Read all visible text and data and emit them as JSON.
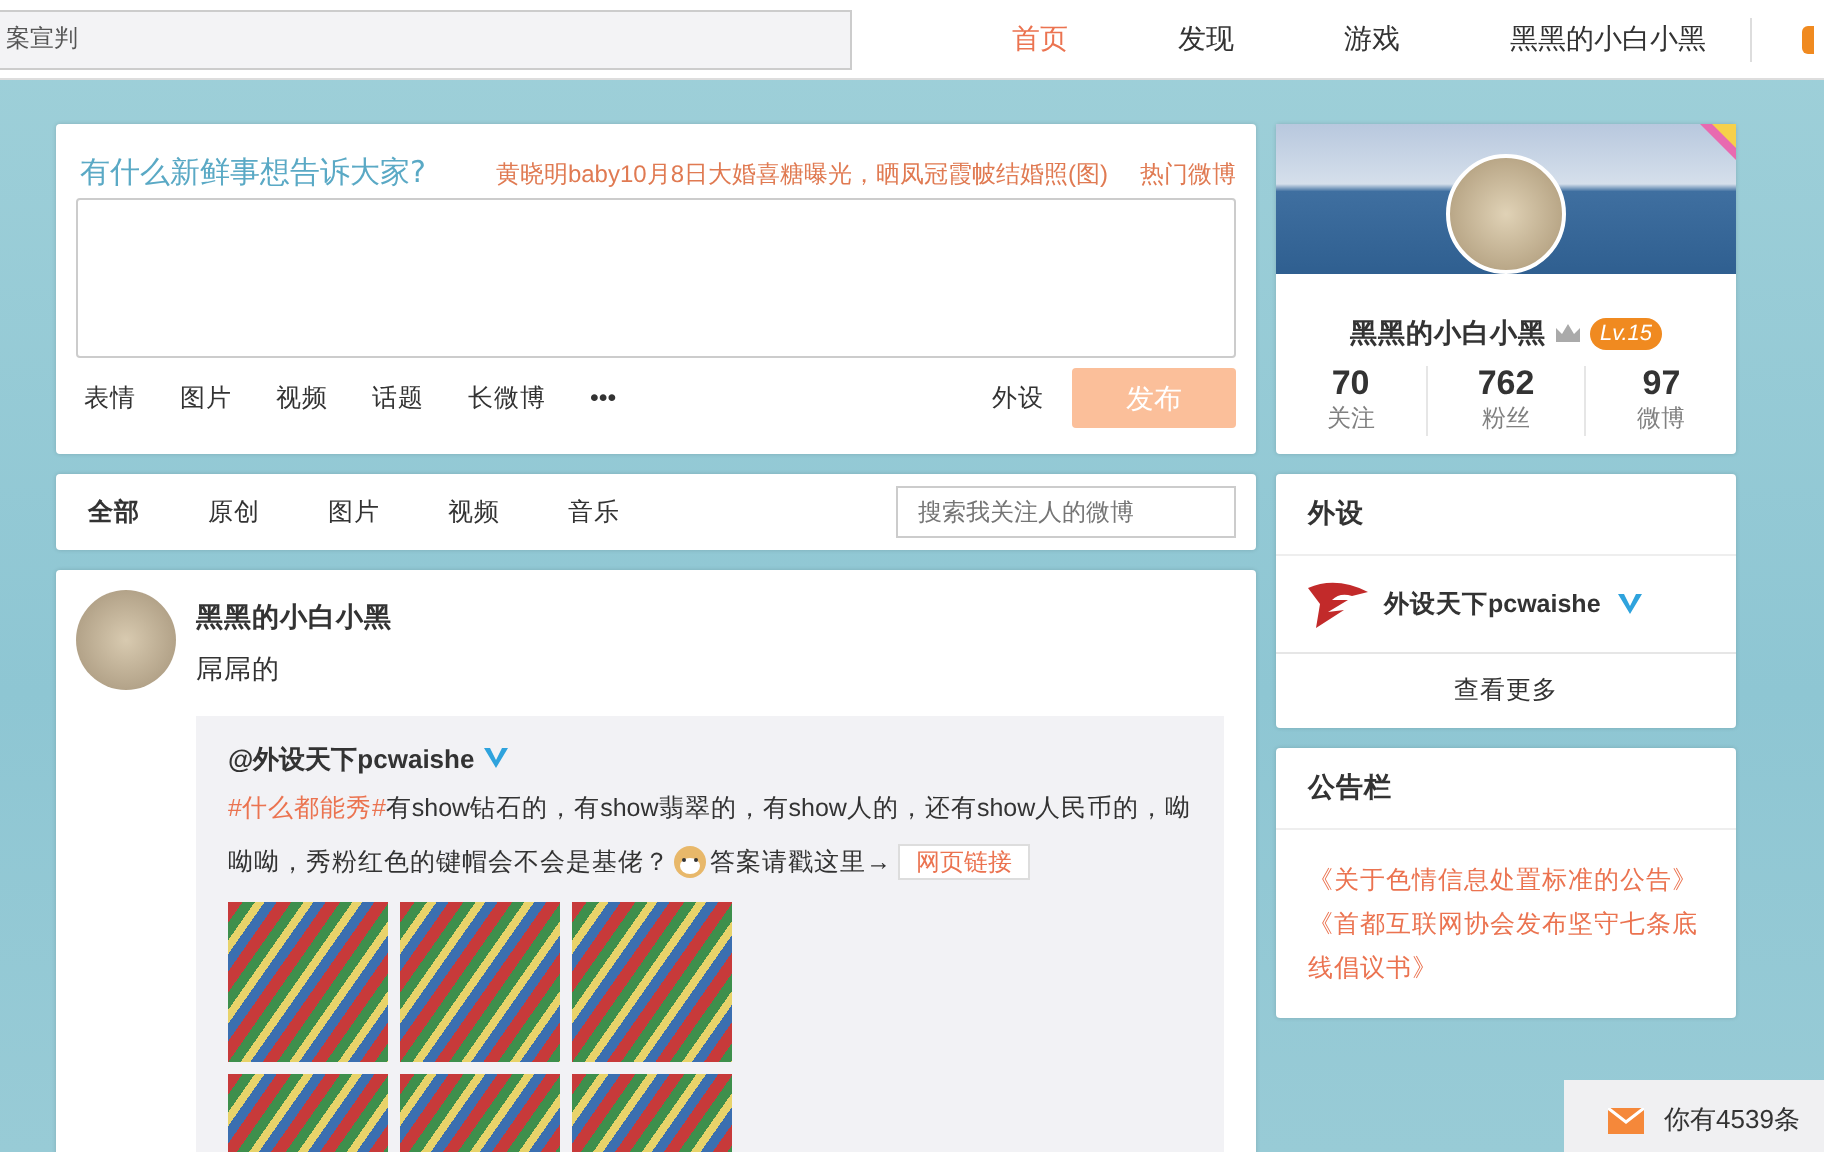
{
  "top_bar": {
    "search": {
      "value": "案宣判"
    },
    "nav": [
      {
        "label": "首页",
        "selected": true
      },
      {
        "label": "发现",
        "selected": false
      },
      {
        "label": "游戏",
        "selected": false
      },
      {
        "label": "黑黑的小白小黑",
        "selected": false
      }
    ]
  },
  "composer": {
    "prompt": "有什么新鲜事想告诉大家?",
    "hot_topic": "黄晓明baby10月8日大婚喜糖曝光，晒凤冠霞帔结婚照(图)",
    "hot_link": "热门微博",
    "tools": [
      "表情",
      "图片",
      "视频",
      "话题",
      "长微博",
      "•••"
    ],
    "group": "外设",
    "publish": "发布",
    "publish_disabled": true
  },
  "feed_tabs": [
    {
      "label": "全部",
      "selected": true
    },
    {
      "label": "原创",
      "selected": false
    },
    {
      "label": "图片",
      "selected": false
    },
    {
      "label": "视频",
      "selected": false
    },
    {
      "label": "音乐",
      "selected": false
    }
  ],
  "feed_search": {
    "placeholder": "搜索我关注人的微博"
  },
  "post": {
    "author": "黑黑的小白小黑",
    "text": "屌屌的",
    "repost": {
      "author": "@外设天下pcwaishe",
      "verified": true,
      "hashtag": "#什么都能秀#",
      "text_before_emoji": "有show钻石的，有show翡翠的，有show人的，还有show人民币的，呦呦呦，秀粉红色的键帽会不会是基佬？",
      "text_after_emoji": "答案请戳这里→",
      "link": "网页链接"
    }
  },
  "profile": {
    "name": "黑黑的小白小黑",
    "level": "Lv.15",
    "stats": [
      {
        "value": "70",
        "label": "关注"
      },
      {
        "value": "762",
        "label": "粉丝"
      },
      {
        "value": "97",
        "label": "微博"
      }
    ]
  },
  "group_card": {
    "title": "外设",
    "member": "外设天下pcwaishe",
    "verified": true,
    "more": "查看更多"
  },
  "notice_card": {
    "title": "公告栏",
    "links": [
      "《关于色情信息处置标准的公告》",
      "《首都互联网协会发布坚守七条底线倡议书》"
    ]
  },
  "notification": {
    "text": "你有4539条"
  }
}
